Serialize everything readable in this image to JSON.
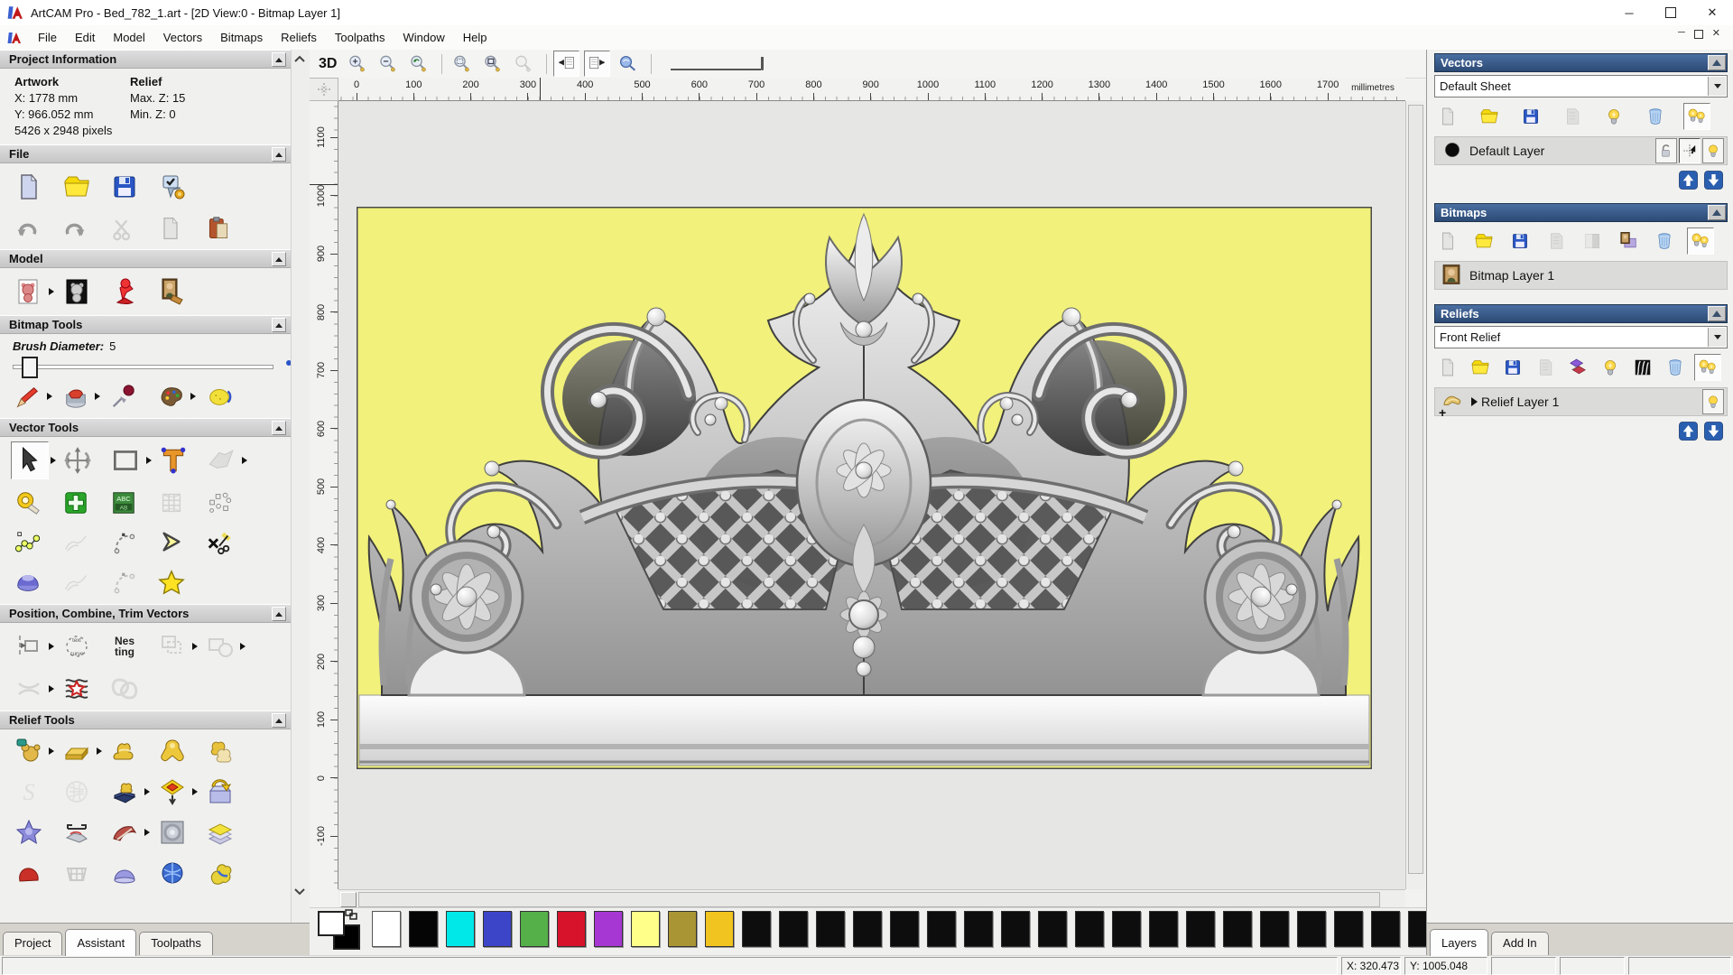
{
  "window": {
    "title": "ArtCAM Pro - Bed_782_1.art - [2D View:0 - Bitmap Layer 1]",
    "controls": [
      "minimize",
      "maximize",
      "close"
    ]
  },
  "menu": {
    "items": [
      "File",
      "Edit",
      "Model",
      "Vectors",
      "Bitmaps",
      "Reliefs",
      "Toolpaths",
      "Window",
      "Help"
    ]
  },
  "assistant": {
    "sections": {
      "project": "Project Information",
      "file": "File",
      "model": "Model",
      "bitmap": "Bitmap Tools",
      "vector": "Vector Tools",
      "position": "Position, Combine, Trim Vectors",
      "relief": "Relief Tools"
    },
    "info": {
      "artwork": "Artwork",
      "x": "X: 1778 mm",
      "y": "Y: 966.052 mm",
      "pixels": "5426 x 2948 pixels",
      "relief": "Relief",
      "maxz": "Max. Z: 15",
      "minz": "Min. Z: 0"
    },
    "brush_label": "Brush Diameter:",
    "brush_value": "5",
    "tabs": [
      "Project",
      "Assistant",
      "Toolpaths"
    ],
    "active_tab": "Assistant",
    "rows": {
      "file1": [
        {
          "n": "new-model-icon",
          "k": "doc"
        },
        {
          "n": "open-model-icon",
          "k": "folder"
        },
        {
          "n": "save-model-icon",
          "k": "floppy"
        },
        {
          "n": "preferences-icon",
          "k": "opts"
        }
      ],
      "file2": [
        {
          "n": "undo-icon",
          "k": "undo"
        },
        {
          "n": "redo-icon",
          "k": "redo"
        },
        {
          "n": "cut-icon",
          "k": "scissors",
          "d": 1
        },
        {
          "n": "copy-icon",
          "k": "doc",
          "d": 1
        },
        {
          "n": "paste-icon",
          "k": "paste"
        }
      ],
      "model": [
        {
          "n": "greyscale-from-model-icon",
          "k": "teddydoc",
          "a": 1
        },
        {
          "n": "greyscale-preview-icon",
          "k": "teddyblk"
        },
        {
          "n": "lighting-icon",
          "k": "lamp"
        },
        {
          "n": "load-bitmap-icon",
          "k": "mona"
        }
      ],
      "bitmap": [
        {
          "n": "paint-icon",
          "k": "pencil",
          "a": 1
        },
        {
          "n": "flood-fill-icon",
          "k": "bucket",
          "a": 1
        },
        {
          "n": "pick-colour-icon",
          "k": "dropper"
        },
        {
          "n": "colour-palette-icon",
          "k": "palette",
          "a": 1
        },
        {
          "n": "texture-brush-icon",
          "k": "sponge"
        }
      ],
      "vt1": [
        {
          "n": "select-vectors-icon",
          "k": "cursor",
          "p": 1,
          "a": 1
        },
        {
          "n": "transform-vectors-icon",
          "k": "xform"
        },
        {
          "n": "create-rectangle-icon",
          "k": "rectv",
          "a": 1
        },
        {
          "n": "create-text-icon",
          "k": "textT"
        },
        {
          "n": "envelope-distort-icon",
          "k": "envel",
          "d": 1,
          "a": 1
        }
      ],
      "vt2": [
        {
          "n": "measure-icon",
          "k": "tape"
        },
        {
          "n": "create-vector-icon",
          "k": "crossg"
        },
        {
          "n": "paste-text-icon",
          "k": "abc"
        },
        {
          "n": "distort-mesh-icon",
          "k": "mesh",
          "d": 1
        },
        {
          "n": "snap-points-icon",
          "k": "dots"
        }
      ],
      "vt3": [
        {
          "n": "node-editing-icon",
          "k": "nodes"
        },
        {
          "n": "free-sketch-icon",
          "k": "sketchy",
          "d": 1
        },
        {
          "n": "arc-editing-icon",
          "k": "arcl"
        },
        {
          "n": "join-vectors-icon",
          "k": "chev"
        },
        {
          "n": "vector-doctor-icon",
          "k": "doctor"
        }
      ],
      "vt4": [
        {
          "n": "wrap-vectors-icon",
          "k": "dome"
        },
        {
          "n": "fit-polyline-icon",
          "k": "sketchy",
          "d": 1
        },
        {
          "n": "mirror-profile-icon",
          "k": "arcl",
          "d": 1
        },
        {
          "n": "create-star-icon",
          "k": "stary"
        }
      ],
      "pc1": [
        {
          "n": "align-vectors-icon",
          "k": "align",
          "a": 1
        },
        {
          "n": "text-on-curve-icon",
          "k": "txtcurve"
        },
        {
          "n": "nesting-icon",
          "k": "nesting"
        },
        {
          "n": "block-copy-icon",
          "k": "combine",
          "d": 1,
          "a": 1
        },
        {
          "n": "weld-vectors-icon",
          "k": "weld",
          "d": 1,
          "a": 1
        }
      ],
      "pc2": [
        {
          "n": "trim-vectors-icon",
          "k": "trim",
          "d": 1,
          "a": 1
        },
        {
          "n": "vector-texture-icon",
          "k": "vtex"
        },
        {
          "n": "interlock-vectors-icon",
          "k": "inter",
          "d": 1
        }
      ],
      "rt1": [
        {
          "n": "calculate-relief-icon",
          "k": "gteddy",
          "a": 1
        },
        {
          "n": "constant-height-relief-icon",
          "k": "ingot",
          "a": 1
        },
        {
          "n": "smooth-relief-icon",
          "k": "gcones"
        },
        {
          "n": "shape-editor-icon",
          "k": "gdome"
        },
        {
          "n": "copy-relief-icon",
          "k": "gcopy"
        }
      ],
      "rt2": [
        {
          "n": "sculpt-icon",
          "k": "sgray",
          "d": 1
        },
        {
          "n": "weave-wizard-icon",
          "k": "celtic",
          "d": 1
        },
        {
          "n": "relief-clipart-library-icon",
          "k": "book",
          "a": 1
        },
        {
          "n": "offset-relief-icon",
          "k": "offsetr",
          "a": 1
        },
        {
          "n": "load-relief-icon",
          "k": "loadrel"
        }
      ],
      "rt3": [
        {
          "n": "star-wizard-icon",
          "k": "bstar"
        },
        {
          "n": "clipart-clamp-icon",
          "k": "clampc"
        },
        {
          "n": "two-rail-sweep-icon",
          "k": "redwave",
          "a": 1
        },
        {
          "n": "texture-relief-icon",
          "k": "emboss"
        },
        {
          "n": "relief-layers-icon",
          "k": "layersy"
        }
      ],
      "rt4": [
        {
          "n": "turn-wizard-icon",
          "k": "redblob"
        },
        {
          "n": "weave-icon",
          "k": "basket",
          "d": 1
        },
        {
          "n": "dome-wizard-icon",
          "k": "bdome2"
        },
        {
          "n": "face-wizard-icon",
          "k": "bsphere"
        },
        {
          "n": "extrude-icon",
          "k": "ybblob"
        }
      ]
    }
  },
  "canvas": {
    "view3d": "3D",
    "ruler_unit": "millimetres",
    "h_labels": [
      "0",
      "100",
      "200",
      "300",
      "400",
      "500",
      "600",
      "700",
      "800",
      "900",
      "1000",
      "1100",
      "1200",
      "1300",
      "1400",
      "1500",
      "1600",
      "1700"
    ],
    "v_labels": [
      "1100",
      "1000",
      "900",
      "800",
      "700",
      "600",
      "500",
      "400",
      "300",
      "200",
      "100",
      "0",
      "-100"
    ],
    "toolbar": [
      {
        "n": "zoom-in-icon",
        "k": "magp"
      },
      {
        "n": "zoom-out-icon",
        "k": "magm"
      },
      {
        "n": "zoom-previous-icon",
        "k": "magb"
      },
      {
        "s": 1
      },
      {
        "n": "zoom-box-icon",
        "k": "magr"
      },
      {
        "n": "zoom-fit-icon",
        "k": "magf"
      },
      {
        "n": "zoom-object-icon",
        "k": "mag0",
        "d": 1
      },
      {
        "s": 1
      },
      {
        "n": "toggle-bitmap-view-icon",
        "k": "tglL",
        "p": 1
      },
      {
        "n": "toggle-vector-view-icon",
        "k": "tglR",
        "p": 1
      },
      {
        "n": "preview-relief-icon",
        "k": "simm"
      },
      {
        "s": 1
      }
    ]
  },
  "layers": {
    "vectors": {
      "title": "Vectors",
      "combo": "Default Sheet",
      "layer": "Default Layer",
      "toolbar": [
        {
          "n": "new-vector-layer-icon",
          "k": "doc",
          "d": 1
        },
        {
          "n": "open-vector-layer-icon",
          "k": "folder"
        },
        {
          "n": "save-vector-layer-icon",
          "k": "floppy"
        },
        {
          "n": "merge-vector-layers-icon",
          "k": "merge",
          "d": 1
        },
        {
          "n": "toggle-layer-visibility-icon",
          "k": "bulb"
        },
        {
          "n": "delete-vector-layer-icon",
          "k": "trash"
        },
        {
          "n": "show-all-vector-layers-icon",
          "k": "bulbs",
          "p": 1
        }
      ]
    },
    "bitmaps": {
      "title": "Bitmaps",
      "layer": "Bitmap Layer 1",
      "toolbar": [
        {
          "n": "new-bitmap-layer-icon",
          "k": "doc",
          "d": 1
        },
        {
          "n": "open-bitmap-layer-icon",
          "k": "folder"
        },
        {
          "n": "save-bitmap-layer-icon",
          "k": "floppy"
        },
        {
          "n": "merge-bitmap-layers-icon",
          "k": "merge",
          "d": 1
        },
        {
          "n": "gradient-layer-icon",
          "k": "gradsq",
          "d": 1
        },
        {
          "n": "bitmap-to-layer-icon",
          "k": "monal"
        },
        {
          "n": "delete-bitmap-layer-icon",
          "k": "trash"
        },
        {
          "n": "show-all-bitmap-layers-icon",
          "k": "bulbs",
          "p": 1
        }
      ]
    },
    "reliefs": {
      "title": "Reliefs",
      "combo": "Front Relief",
      "layer": "Relief Layer 1",
      "toolbar": [
        {
          "n": "new-relief-layer-icon",
          "k": "doc",
          "d": 1
        },
        {
          "n": "open-relief-layer-icon",
          "k": "folder"
        },
        {
          "n": "save-relief-layer-icon",
          "k": "floppy"
        },
        {
          "n": "merge-relief-layers-icon",
          "k": "merge",
          "d": 1
        },
        {
          "n": "stack-relief-layers-icon",
          "k": "stackpr"
        },
        {
          "n": "toggle-relief-visibility-icon",
          "k": "bulb"
        },
        {
          "n": "greyscale-view-icon",
          "k": "zebra"
        },
        {
          "n": "delete-relief-layer-icon",
          "k": "trash"
        },
        {
          "n": "show-all-relief-layers-icon",
          "k": "bulbs",
          "p": 1
        }
      ]
    },
    "tabs": [
      "Layers",
      "Add In"
    ],
    "active_tab": "Layers"
  },
  "status": {
    "x": "X: 320.473",
    "y": "Y: 1005.048"
  },
  "palette": {
    "colors": [
      "#ffffff",
      "#050505",
      "#00e8e8",
      "#3c45c8",
      "#55b04a",
      "#d6132b",
      "#a637d2",
      "#ffff8a",
      "#aa9535",
      "#f1c41f",
      "#0d0d0d",
      "#0d0d0d",
      "#0d0d0d",
      "#0d0d0d",
      "#0d0d0d",
      "#0d0d0d",
      "#0d0d0d",
      "#0d0d0d",
      "#0d0d0d",
      "#0d0d0d",
      "#0d0d0d",
      "#0d0d0d",
      "#0d0d0d",
      "#0d0d0d",
      "#0d0d0d",
      "#0d0d0d",
      "#0d0d0d",
      "#0d0d0d",
      "#0d0d0d"
    ],
    "background_color": "#f1f17b",
    "accent_blue": "#2c4a74"
  }
}
